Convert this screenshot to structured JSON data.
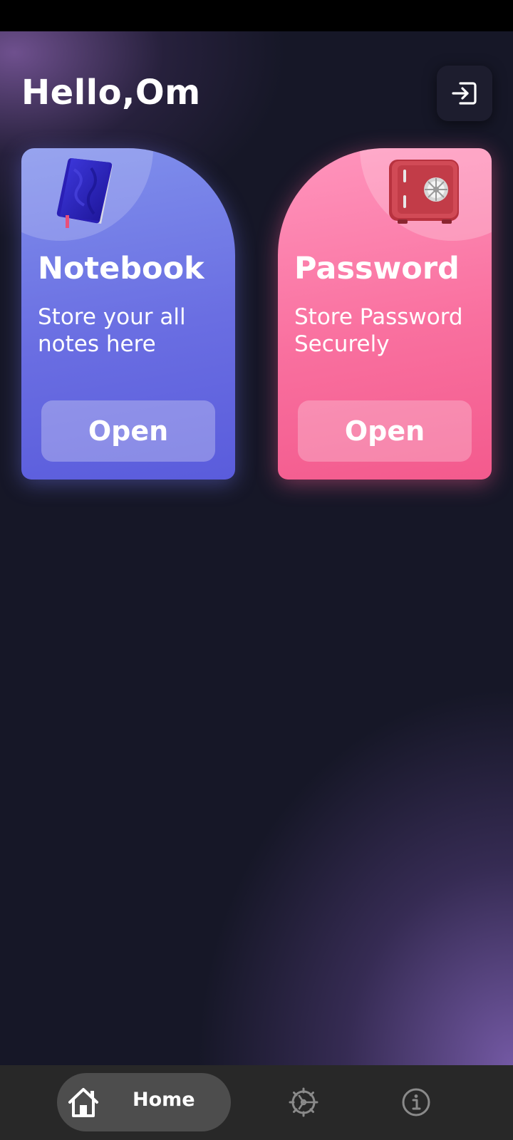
{
  "header": {
    "greeting": "Hello,Om",
    "logout_icon": "logout-icon"
  },
  "cards": [
    {
      "title": "Notebook",
      "description": "Store your all notes here",
      "button_label": "Open",
      "icon": "notebook-icon",
      "color": "#6a6ee2"
    },
    {
      "title": "Password",
      "description": "Store Password Securely",
      "button_label": "Open",
      "icon": "safe-icon",
      "color": "#f9709f"
    }
  ],
  "bottom_nav": {
    "home_label": "Home",
    "home_icon": "home-icon",
    "settings_icon": "settings-icon",
    "info_icon": "info-icon"
  },
  "colors": {
    "background": "#161727",
    "nav_background": "#282828",
    "nav_active": "#4d4d4d"
  }
}
